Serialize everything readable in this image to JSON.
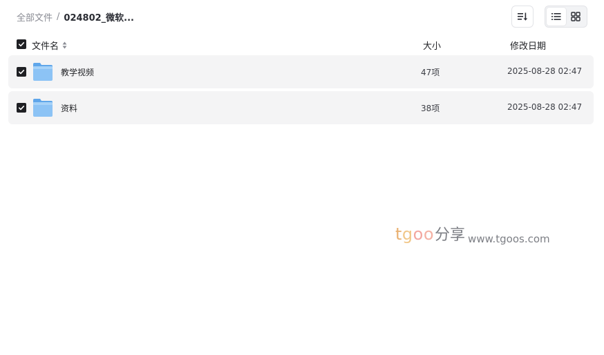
{
  "breadcrumb": {
    "root": "全部文件",
    "separator": "/",
    "current": "024802_微软..."
  },
  "toolbar": {
    "sort_icon": "sort-list-icon",
    "view_modes": [
      {
        "icon": "list-view-icon",
        "active": true
      },
      {
        "icon": "grid-view-icon",
        "active": false
      }
    ]
  },
  "columns": {
    "name": "文件名",
    "size": "大小",
    "date": "修改日期"
  },
  "files": [
    {
      "name": "教学视频",
      "size": "47项",
      "date": "2025-08-28 02:47",
      "type": "folder",
      "checked": true
    },
    {
      "name": "资料",
      "size": "38项",
      "date": "2025-08-28 02:47",
      "type": "folder",
      "checked": true
    }
  ],
  "watermark": {
    "brand": "tgoo",
    "brand_cn": "分享",
    "url": "www.tgoos.com"
  },
  "colors": {
    "row_bg": "#f4f4f5",
    "checkbox": "#1f2024",
    "folder": "#7cb8f2"
  }
}
